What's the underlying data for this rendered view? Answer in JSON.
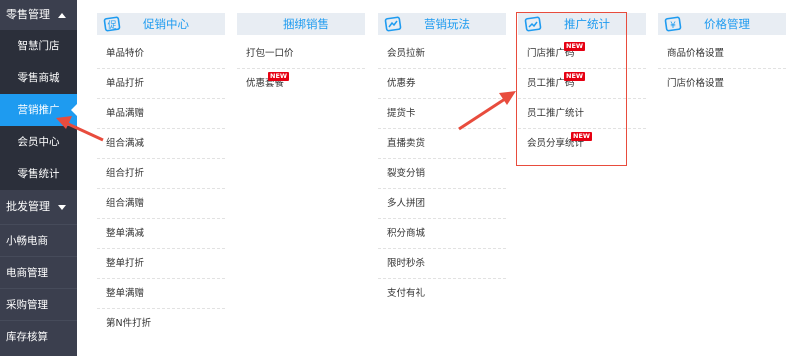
{
  "sidebar": {
    "retail_header": "零售管理",
    "retail_items": [
      "智慧门店",
      "零售商城",
      "营销推广",
      "会员中心",
      "零售统计"
    ],
    "active_item": "营销推广",
    "wholesale_header": "批发管理",
    "other_items": [
      "小畅电商",
      "电商管理",
      "采购管理",
      "库存核算"
    ]
  },
  "columns": [
    {
      "title": "促销中心",
      "icon": "promotion-icon",
      "items": [
        {
          "label": "单品特价"
        },
        {
          "label": "单品打折"
        },
        {
          "label": "单品满赠"
        },
        {
          "label": "组合满减"
        },
        {
          "label": "组合打折"
        },
        {
          "label": "组合满赠"
        },
        {
          "label": "整单满减"
        },
        {
          "label": "整单打折"
        },
        {
          "label": "整单满赠"
        },
        {
          "label": "第N件打折"
        }
      ]
    },
    {
      "title": "捆绑销售",
      "icon": "",
      "items": [
        {
          "label": "打包一口价"
        },
        {
          "label": "优惠套餐",
          "badge": "NEW"
        }
      ]
    },
    {
      "title": "营销玩法",
      "icon": "marketing-icon",
      "items": [
        {
          "label": "会员拉新"
        },
        {
          "label": "优惠券"
        },
        {
          "label": "提货卡"
        },
        {
          "label": "直播卖货"
        },
        {
          "label": "裂变分销"
        },
        {
          "label": "多人拼团"
        },
        {
          "label": "积分商城"
        },
        {
          "label": "限时秒杀"
        },
        {
          "label": "支付有礼"
        }
      ]
    },
    {
      "title": "推广统计",
      "icon": "statistics-icon",
      "items": [
        {
          "label": "门店推广码",
          "badge": "NEW"
        },
        {
          "label": "员工推广码",
          "badge": "NEW"
        },
        {
          "label": "员工推广统计"
        },
        {
          "label": "会员分享统计",
          "badge": "NEW"
        }
      ]
    },
    {
      "title": "价格管理",
      "icon": "price-icon",
      "items": [
        {
          "label": "商品价格设置"
        },
        {
          "label": "门店价格设置"
        }
      ]
    }
  ],
  "colors": {
    "accent": "#1e9bf0",
    "sidebar": "#3b3f4e",
    "highlight": "#e84c3d",
    "badge": "#e60012"
  }
}
